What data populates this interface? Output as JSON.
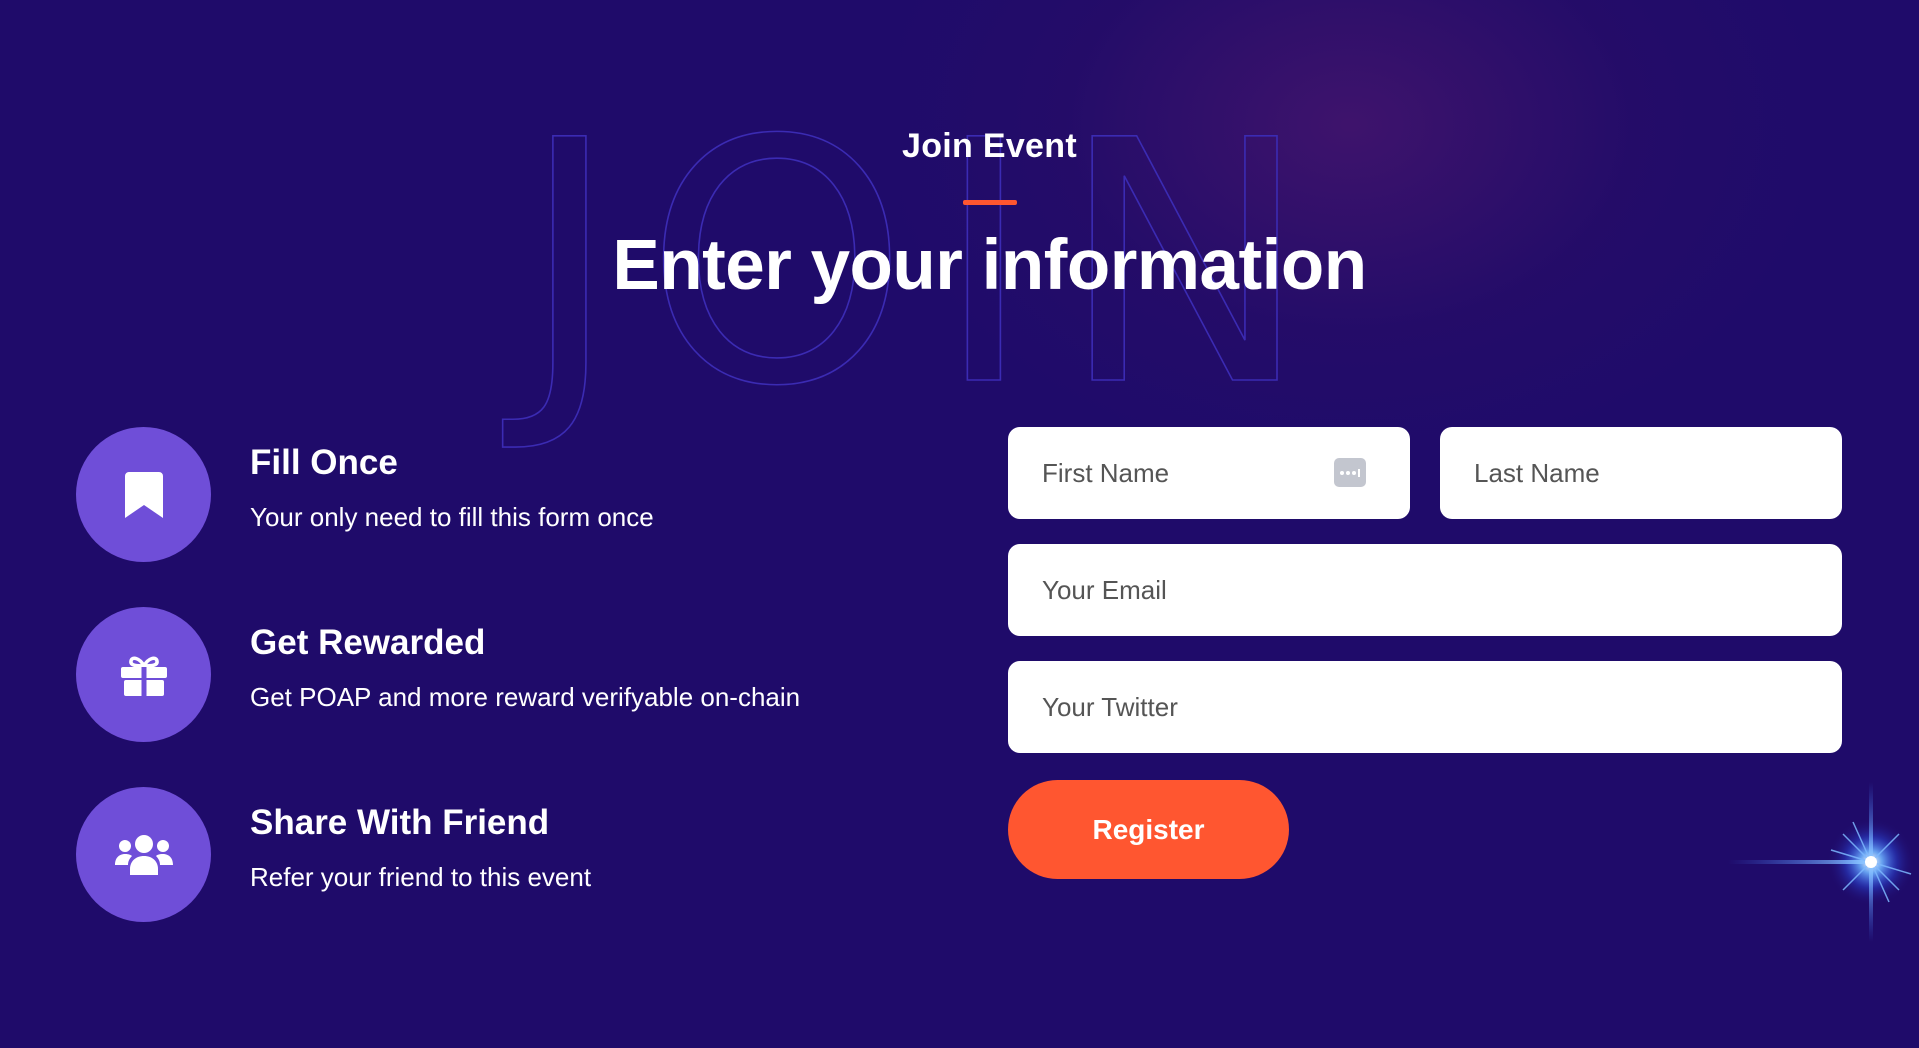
{
  "background": {
    "color": "#1f0b6a",
    "watermark_text": "JOIN"
  },
  "header": {
    "kicker": "Join Event",
    "title": "Enter your information",
    "accent_color": "#ff5630"
  },
  "features": [
    {
      "icon": "bookmark-icon",
      "title": "Fill Once",
      "description": "Your only need to fill this form once"
    },
    {
      "icon": "gift-icon",
      "title": "Get Rewarded",
      "description": "Get POAP and more reward verifyable on-chain"
    },
    {
      "icon": "users-icon",
      "title": "Share With Friend",
      "description": "Refer your friend to this event"
    }
  ],
  "form": {
    "first_name_placeholder": "First Name",
    "last_name_placeholder": "Last Name",
    "email_placeholder": "Your Email",
    "twitter_placeholder": "Your Twitter",
    "register_label": "Register",
    "autofill_icon": "password-manager-icon"
  },
  "colors": {
    "feature_circle": "#6f4ed8",
    "button": "#ff5630",
    "field_bg": "#ffffff"
  }
}
